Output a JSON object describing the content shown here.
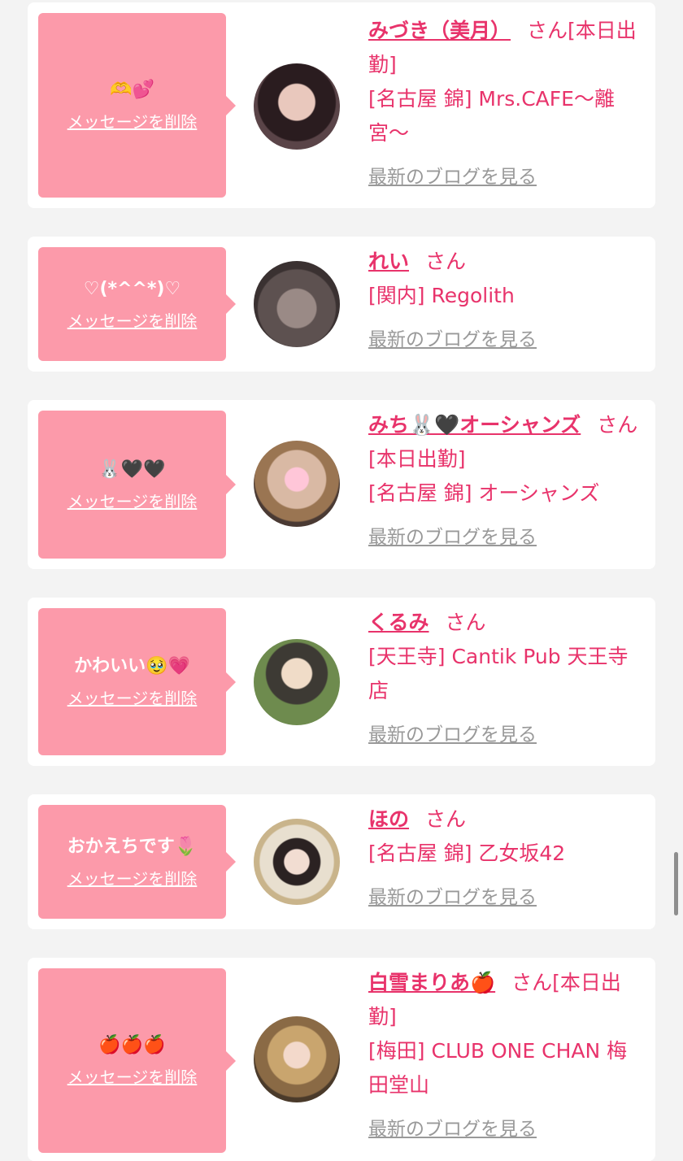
{
  "colors": {
    "accent": "#e8336b",
    "bubble": "#fc9aaa",
    "muted": "#999999",
    "background": "#f3f3f3"
  },
  "delete_label": "メッセージを削除",
  "blog_label": "最新のブログを見る",
  "san_label": "さん",
  "items": [
    {
      "message": "🫶💕",
      "name": "みづき（美月）",
      "attendance": "[本日出勤]",
      "shop": "[名古屋 錦] Mrs.CAFE〜離宮〜"
    },
    {
      "message": "♡(*^^*)♡",
      "name": "れい",
      "attendance": "",
      "shop": "[関内] Regolith"
    },
    {
      "message": "🐰🖤🖤",
      "name": "みち🐰🖤オーシャンズ",
      "attendance": "[本日出勤]",
      "shop": "[名古屋 錦] オーシャンズ"
    },
    {
      "message": "かわいい🥹💗",
      "name": "くるみ",
      "attendance": "",
      "shop": "[天王寺] Cantik Pub 天王寺店"
    },
    {
      "message": "おかえちです🌷",
      "name": "ほの",
      "attendance": "",
      "shop": "[名古屋 錦] 乙女坂42"
    },
    {
      "message": "🍎🍎🍎",
      "name": "白雪まりあ🍎",
      "attendance": "[本日出勤]",
      "shop": "[梅田] CLUB ONE CHAN 梅田堂山"
    }
  ]
}
